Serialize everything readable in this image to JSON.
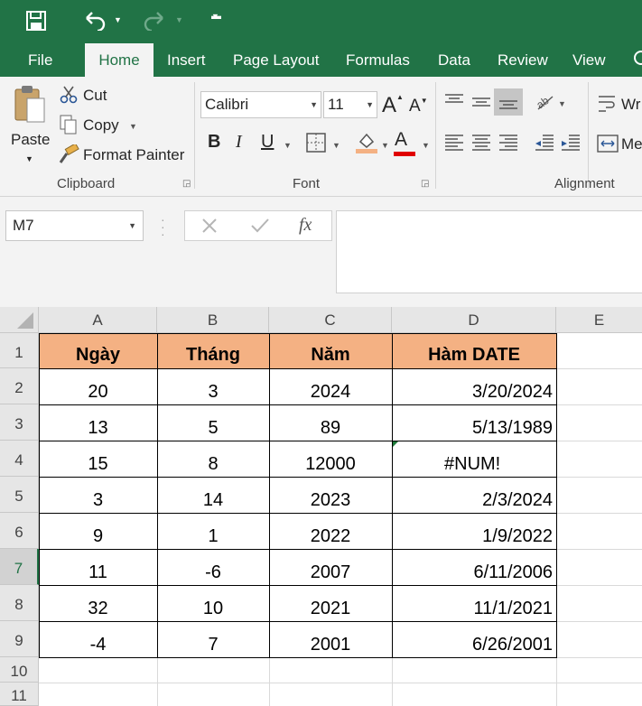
{
  "ribbon_tabs": {
    "file": "File",
    "home": "Home",
    "insert": "Insert",
    "page_layout": "Page Layout",
    "formulas": "Formulas",
    "data": "Data",
    "review": "Review",
    "view": "View"
  },
  "clipboard": {
    "paste": "Paste",
    "cut": "Cut",
    "copy": "Copy",
    "format_painter": "Format Painter",
    "group_label": "Clipboard"
  },
  "font": {
    "name": "Calibri",
    "size": "11",
    "grow": "A",
    "shrink": "A",
    "bold": "B",
    "italic": "I",
    "underline": "U",
    "font_color": "A",
    "group_label": "Font"
  },
  "alignment": {
    "wrap": "Wr",
    "merge": "Me",
    "group_label": "Alignment"
  },
  "formula_bar": {
    "name_box": "M7",
    "fx": "fx",
    "content": ""
  },
  "colors": {
    "ribbon_green": "#217346",
    "header_fill": "#f4b183",
    "highlight_yellow": "#f4b183",
    "font_red": "#e00000"
  },
  "sheet": {
    "columns": [
      "A",
      "B",
      "C",
      "D",
      "E"
    ],
    "rows": [
      "1",
      "2",
      "3",
      "4",
      "5",
      "6",
      "7",
      "8",
      "9",
      "10",
      "11"
    ],
    "selected_row": "7",
    "header": [
      "Ngày",
      "Tháng",
      "Năm",
      "Hàm DATE"
    ],
    "data": [
      [
        "20",
        "3",
        "2024",
        "3/20/2024"
      ],
      [
        "13",
        "5",
        "89",
        "5/13/1989"
      ],
      [
        "15",
        "8",
        "12000",
        "#NUM!"
      ],
      [
        "3",
        "14",
        "2023",
        "2/3/2024"
      ],
      [
        "9",
        "1",
        "2022",
        "1/9/2022"
      ],
      [
        "11",
        "-6",
        "2007",
        "6/11/2006"
      ],
      [
        "32",
        "10",
        "2021",
        "11/1/2021"
      ],
      [
        "-4",
        "7",
        "2001",
        "6/26/2001"
      ]
    ]
  }
}
